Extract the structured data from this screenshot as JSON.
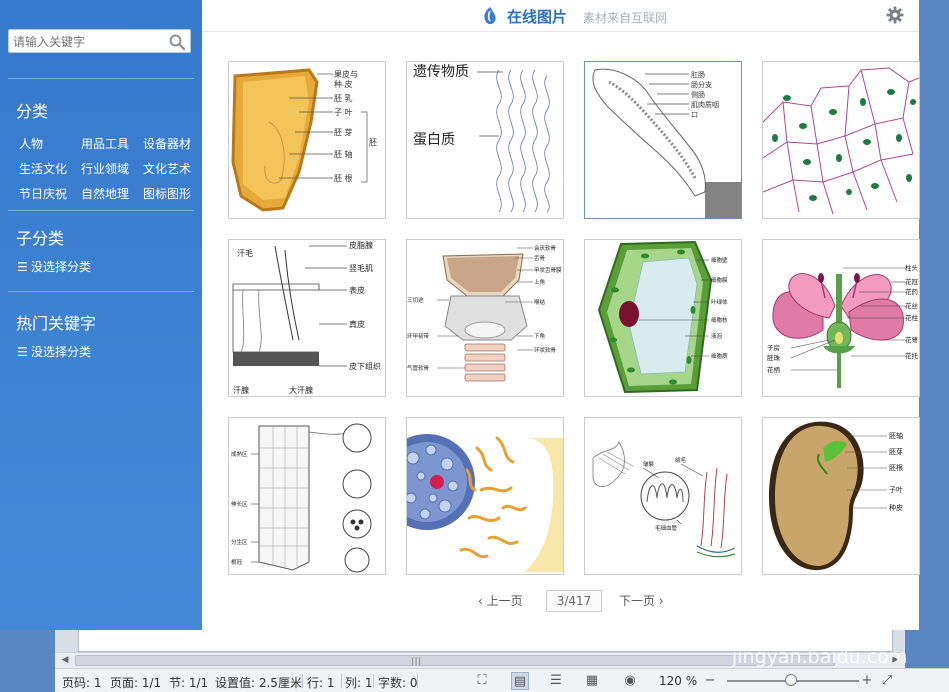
{
  "dialog": {
    "brand_title": "在线图片",
    "brand_sub": "素材来自互联网",
    "accent": "#2f6fc0",
    "sidebar_color": "#3779cc"
  },
  "search": {
    "placeholder": "请输入关键字"
  },
  "sidebar": {
    "category_heading": "分类",
    "categories": [
      "人物",
      "用品工具",
      "设备器材",
      "生活文化",
      "行业领域",
      "文化艺术",
      "节日庆祝",
      "自然地理",
      "图标图形"
    ],
    "subcategory_heading": "子分类",
    "subcategory_link": "没选择分类",
    "hot_heading": "热门关键字",
    "hot_link": "没选择分类"
  },
  "tiles": [
    {
      "name": "seed-structure",
      "labels": [
        "果皮与",
        "种  皮",
        "胚  乳",
        "子  叶",
        "胚  芽",
        "胚  轴",
        "胚  根",
        "胚"
      ]
    },
    {
      "name": "dna-chromosome",
      "labels": [
        "遗传物质",
        "蛋白质"
      ]
    },
    {
      "name": "earthworm-anatomy",
      "labels": [
        "肛肠",
        "肠分支",
        "侧肠",
        "肌肉质咽",
        "口"
      ]
    },
    {
      "name": "plant-cells",
      "labels": []
    },
    {
      "name": "skin-section",
      "labels": [
        "汗毛",
        "皮脂腺",
        "竖毛肌",
        "表皮",
        "真皮",
        "皮下组织",
        "汗腺",
        "大汗腺"
      ]
    },
    {
      "name": "larynx",
      "labels": [
        "会厌软骨",
        "舌骨",
        "甲状舌骨膜",
        "上角",
        "喉结",
        "三切迹",
        "环甲韧带",
        "下角",
        "环状软骨",
        "气管软骨"
      ]
    },
    {
      "name": "plant-cell",
      "labels": [
        "细胞壁",
        "细胞膜",
        "叶绿体",
        "细胞核",
        "液泡",
        "细胞质"
      ]
    },
    {
      "name": "flower-structure",
      "labels": [
        "柱头",
        "花冠",
        "花药",
        "花丝",
        "花柱",
        "花萼",
        "花托",
        "子房",
        "胚珠",
        "花柄"
      ]
    },
    {
      "name": "root-tip",
      "labels": [
        "成熟区",
        "伸长区",
        "分生区",
        "根冠"
      ]
    },
    {
      "name": "cell-organelles",
      "labels": []
    },
    {
      "name": "intestine-villi",
      "labels": [
        "皱襞",
        "绒毛",
        "毛细血管"
      ]
    },
    {
      "name": "bean-seed",
      "labels": [
        "胚轴",
        "胚芽",
        "胚根",
        "子叶",
        "种皮"
      ]
    }
  ],
  "pager": {
    "prev": "上一页",
    "next": "下一页",
    "current": "3/417"
  },
  "statusbar": {
    "page_code": "页码: 1",
    "page": "页面: 1/1",
    "section": "节: 1/1",
    "setting": "设置值: 2.5厘米",
    "row": "行: 1",
    "col": "列: 1",
    "words": "字数: 0",
    "zoom": "120 %"
  },
  "watermark": {
    "line1": "Baidu经验",
    "line2": "jingyan.baidu.com"
  }
}
